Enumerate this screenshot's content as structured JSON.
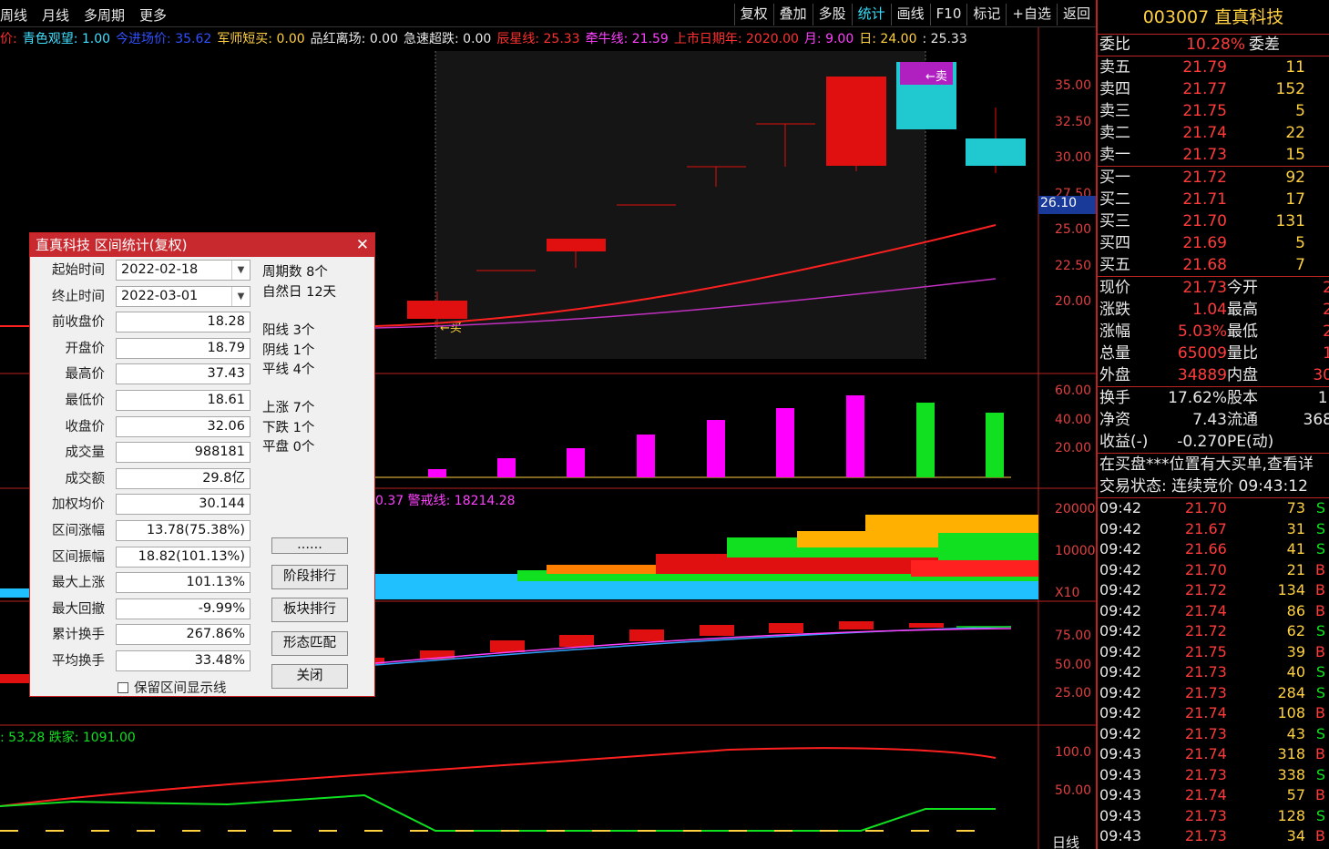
{
  "topbar": {
    "left": [
      "周线",
      "月线",
      "多周期",
      "更多"
    ],
    "right": [
      "复权",
      "叠加",
      "多股",
      "统计",
      "画线",
      "F10",
      "标记",
      "+自选",
      "返回"
    ],
    "active": "统计"
  },
  "indicator_line": [
    {
      "text": "价:",
      "color": "#ff3030"
    },
    {
      "text": "青色观望: 1.00",
      "color": "#40e0ff"
    },
    {
      "text": "今进场价: 35.62",
      "color": "#3050ff"
    },
    {
      "text": "军师短买: 0.00",
      "color": "#ffd040"
    },
    {
      "text": "品红离场: 0.00",
      "color": "#e8e8e8"
    },
    {
      "text": "急速超跌: 0.00",
      "color": "#e8e8e8"
    },
    {
      "text": "辰星线: 25.33",
      "color": "#ff3030"
    },
    {
      "text": "牵牛线: 21.59",
      "color": "#ff40ff"
    },
    {
      "text": "上市日期年: 2020.00",
      "color": "#ff3030"
    },
    {
      "text": "月: 9.00",
      "color": "#ff40ff"
    },
    {
      "text": "日: 24.00",
      "color": "#ffd040"
    },
    {
      "text": ": 25.33",
      "color": "#e8e8e8"
    }
  ],
  "price_axis": [
    "35.00",
    "32.50",
    "30.00",
    "27.50",
    "25.00",
    "22.50",
    "20.00"
  ],
  "price_tag": "26.10",
  "vol_axis": [
    "60.00",
    "40.00",
    "20.00"
  ],
  "ind3_axis": [
    "20000",
    "10000",
    "X10"
  ],
  "ind3_text": "0.37 警戒线: 18214.28",
  "ind4_axis": [
    "75.00",
    "50.00",
    "25.00"
  ],
  "ind5_axis": [
    "100.0",
    "50.00"
  ],
  "ind5_text": ": 53.28  跌家: 1091.00",
  "bottom_label": "日线",
  "chart_markers": {
    "sell": "←卖",
    "buy": "←买"
  },
  "right_panel": {
    "title": "003007 直真科技",
    "webi": {
      "label": "委比",
      "value": "10.28%",
      "label2": "委差"
    },
    "sell": [
      {
        "label": "卖五",
        "price": "21.79",
        "vol": "11"
      },
      {
        "label": "卖四",
        "price": "21.77",
        "vol": "152"
      },
      {
        "label": "卖三",
        "price": "21.75",
        "vol": "5"
      },
      {
        "label": "卖二",
        "price": "21.74",
        "vol": "22"
      },
      {
        "label": "卖一",
        "price": "21.73",
        "vol": "15"
      }
    ],
    "buy": [
      {
        "label": "买一",
        "price": "21.72",
        "vol": "92"
      },
      {
        "label": "买二",
        "price": "21.71",
        "vol": "17"
      },
      {
        "label": "买三",
        "price": "21.70",
        "vol": "131"
      },
      {
        "label": "买四",
        "price": "21.69",
        "vol": "5"
      },
      {
        "label": "买五",
        "price": "21.68",
        "vol": "7"
      }
    ],
    "quote": [
      {
        "l1": "现价",
        "v1": "21.73",
        "l2": "今开",
        "v2": "2"
      },
      {
        "l1": "涨跌",
        "v1": "1.04",
        "l2": "最高",
        "v2": "2"
      },
      {
        "l1": "涨幅",
        "v1": "5.03%",
        "l2": "最低",
        "v2": "2"
      },
      {
        "l1": "总量",
        "v1": "65009",
        "l2": "量比",
        "v2": "1"
      },
      {
        "l1": "外盘",
        "v1": "34889",
        "l2": "内盘",
        "v2": "30"
      }
    ],
    "fund": [
      {
        "l1": "换手",
        "v1": "17.62%",
        "l2": "股本",
        "v2": "1."
      },
      {
        "l1": "净资",
        "v1": "7.43",
        "l2": "流通",
        "v2": "368"
      },
      {
        "l1": "收益(-)",
        "v1": "-0.270",
        "l2": "PE(动)",
        "v2": ""
      }
    ],
    "notice": "在买盘***位置有大买单,查看详",
    "status": "交易状态: 连续竞价 09:43:12",
    "ticks": [
      {
        "t": "09:42",
        "p": "21.70",
        "v": "73",
        "bs": "S"
      },
      {
        "t": "09:42",
        "p": "21.67",
        "v": "31",
        "bs": "S"
      },
      {
        "t": "09:42",
        "p": "21.66",
        "v": "41",
        "bs": "S"
      },
      {
        "t": "09:42",
        "p": "21.70",
        "v": "21",
        "bs": "B"
      },
      {
        "t": "09:42",
        "p": "21.72",
        "v": "134",
        "bs": "B"
      },
      {
        "t": "09:42",
        "p": "21.74",
        "v": "86",
        "bs": "B"
      },
      {
        "t": "09:42",
        "p": "21.72",
        "v": "62",
        "bs": "S"
      },
      {
        "t": "09:42",
        "p": "21.75",
        "v": "39",
        "bs": "B"
      },
      {
        "t": "09:42",
        "p": "21.73",
        "v": "40",
        "bs": "S"
      },
      {
        "t": "09:42",
        "p": "21.73",
        "v": "284",
        "bs": "S"
      },
      {
        "t": "09:42",
        "p": "21.74",
        "v": "108",
        "bs": "B"
      },
      {
        "t": "09:42",
        "p": "21.73",
        "v": "43",
        "bs": "S"
      },
      {
        "t": "09:43",
        "p": "21.74",
        "v": "318",
        "bs": "B"
      },
      {
        "t": "09:43",
        "p": "21.73",
        "v": "338",
        "bs": "S"
      },
      {
        "t": "09:43",
        "p": "21.74",
        "v": "57",
        "bs": "B"
      },
      {
        "t": "09:43",
        "p": "21.73",
        "v": "128",
        "bs": "S"
      },
      {
        "t": "09:43",
        "p": "21.73",
        "v": "34",
        "bs": "B"
      }
    ]
  },
  "dialog": {
    "title": "直真科技 区间统计(复权)",
    "close": "✕",
    "fields": [
      {
        "label": "起始时间",
        "value": "2022-02-18",
        "type": "date"
      },
      {
        "label": "终止时间",
        "value": "2022-03-01",
        "type": "date"
      },
      {
        "label": "前收盘价",
        "value": "18.28"
      },
      {
        "label": "开盘价",
        "value": "18.79"
      },
      {
        "label": "最高价",
        "value": "37.43"
      },
      {
        "label": "最低价",
        "value": "18.61"
      },
      {
        "label": "收盘价",
        "value": "32.06"
      },
      {
        "label": "成交量",
        "value": "988181"
      },
      {
        "label": "成交额",
        "value": "29.8亿"
      },
      {
        "label": "加权均价",
        "value": "30.144"
      },
      {
        "label": "区间涨幅",
        "value": "13.78(75.38%)"
      },
      {
        "label": "区间振幅",
        "value": "18.82(101.13%)"
      },
      {
        "label": "最大上涨",
        "value": "101.13%"
      },
      {
        "label": "最大回撤",
        "value": "-9.99%"
      },
      {
        "label": "累计换手",
        "value": "267.86%"
      },
      {
        "label": "平均换手",
        "value": "33.48%"
      }
    ],
    "stats": [
      "周期数 8个",
      "自然日 12天",
      "阳线 3个",
      "阴线 1个",
      "平线 4个",
      "上涨 7个",
      "下跌 1个",
      "平盘 0个"
    ],
    "buttons": [
      "......",
      "阶段排行",
      "板块排行",
      "形态匹配",
      "关闭"
    ],
    "checkbox": "保留区间显示线"
  }
}
